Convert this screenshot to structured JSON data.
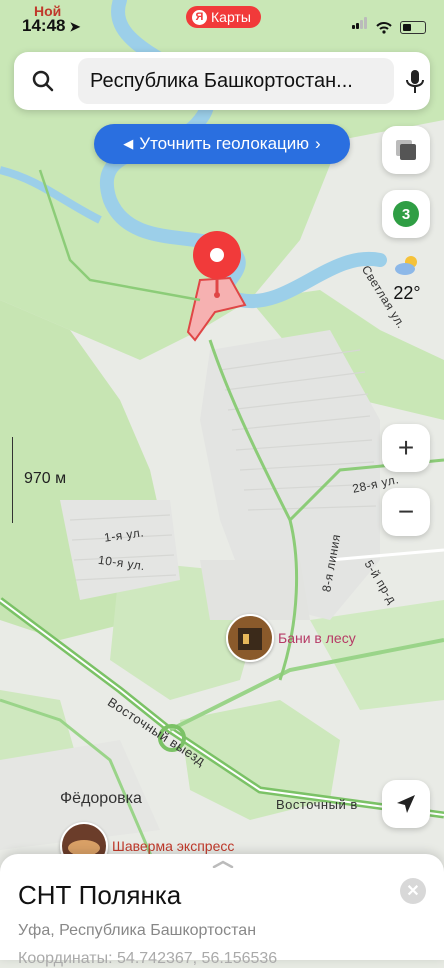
{
  "status": {
    "time": "14:48",
    "carrier_fragment": "Ной",
    "brand_label": "Карты",
    "brand_badge": "Я"
  },
  "search": {
    "value": "Республика Башкортостан..."
  },
  "geolocation_button": "Уточнить геолокацию",
  "traffic_level": "3",
  "weather": {
    "temperature": "22°"
  },
  "zoom_in_label": "+",
  "zoom_out_label": "−",
  "scale_label": "970 м",
  "map_labels": {
    "street_1": "1-я ул.",
    "street_10": "10-я ул.",
    "street_28": "28-я ул.",
    "line_8": "8-я линия",
    "proezd_5": "5-й пр-д",
    "svetlaya": "Светлая ул.",
    "vostochny_1": "Восточный выезд",
    "vostochny_2": "Восточный в",
    "fedorovka": "Фёдоровка"
  },
  "pois": {
    "bani": "Бани в лесу",
    "shaverma": "Шаверма экспресс"
  },
  "place": {
    "title": "СНТ Полянка",
    "subtitle": "Уфа, Республика Башкортостан",
    "coords": "Координаты: 54.742367, 56.156536"
  },
  "colors": {
    "forest": "#c5e5b2",
    "river": "#8ec9e8",
    "road": "#7cc46a",
    "accent": "#2a6fe0",
    "pin": "#f13a3a"
  }
}
